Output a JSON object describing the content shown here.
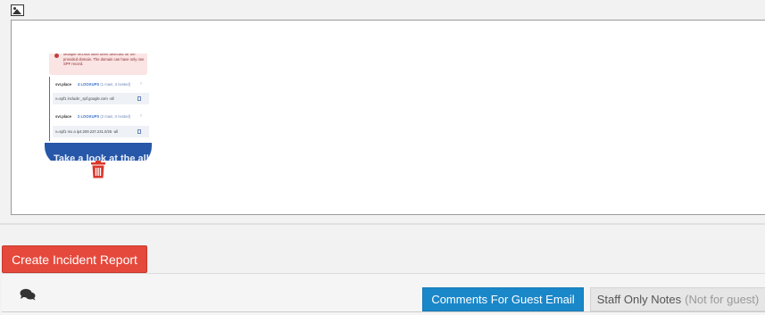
{
  "preview": {
    "alert_text": "Multiple records have been detected for the provided domain. The domain can have only one SPF record.",
    "rows": [
      {
        "host": "svr.place",
        "count": "4 LOOKUPS",
        "detail": "(1 main, 3 nested)"
      },
      {
        "value": "v=spf1 include:_spf.google.com -all"
      },
      {
        "host": "svr.place",
        "count": "2 LOOKUPS",
        "detail": "(2 main, 0 nested)"
      },
      {
        "value": "v=spf1 mx a ip4:209.237.231.0/25 -all"
      }
    ],
    "banner_text": "Take a look at the all"
  },
  "actions": {
    "create_incident_label": "Create Incident Report"
  },
  "comments": {
    "tab_guest_label": "Comments For Guest Email",
    "tab_staff_label": "Staff Only Notes",
    "tab_staff_note": "(Not for guest)"
  },
  "colors": {
    "incident_red": "#e5493c",
    "active_tab_blue": "#1a87c9",
    "trash_red": "#d9362b"
  },
  "icons": {
    "image": "image-icon",
    "trash": "trash-icon",
    "chat": "comments-icon"
  }
}
